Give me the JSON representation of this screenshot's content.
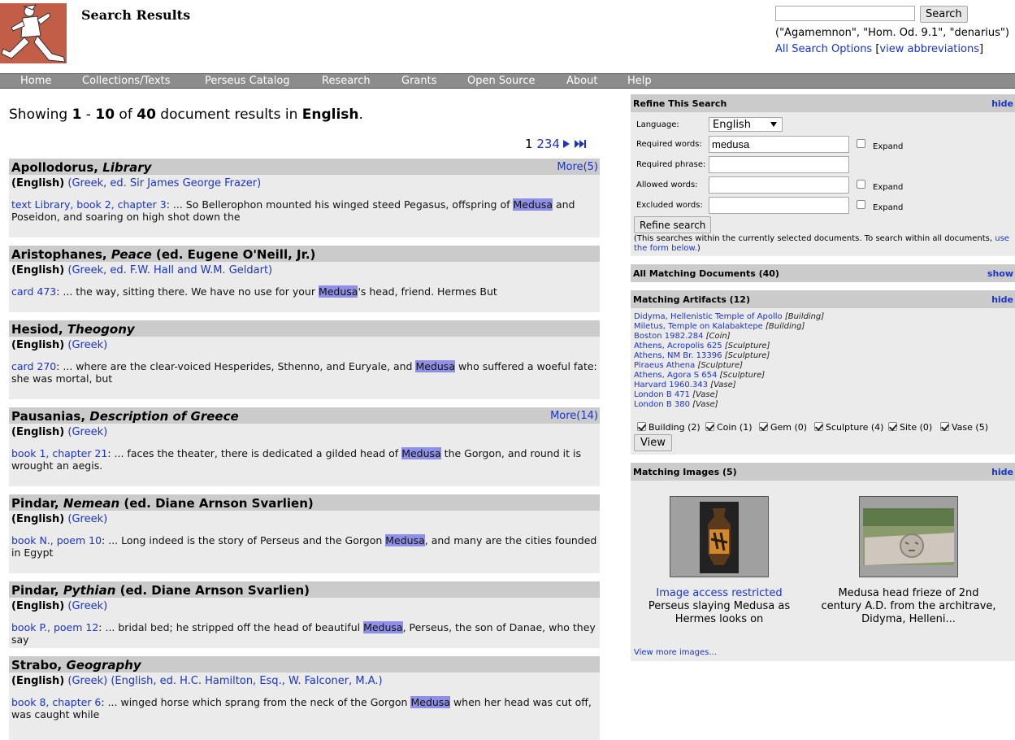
{
  "header": {
    "title": "Search Results",
    "search_value": "",
    "search_button": "Search",
    "search_hint": "(\"Agamemnon\", \"Hom. Od. 9.1\", \"denarius\")",
    "all_options": "All Search Options",
    "bracket_open": "[",
    "view_abbrev": "view abbreviations",
    "bracket_close": "]"
  },
  "nav": [
    "Home",
    "Collections/Texts",
    "Perseus Catalog",
    "Research",
    "Grants",
    "Open Source",
    "About",
    "Help"
  ],
  "summary": {
    "prefix": "Showing ",
    "from": "1",
    "dash": " - ",
    "to": "10",
    "of": " of ",
    "total": "40",
    "mid": " document results in ",
    "language": "English",
    "end": "."
  },
  "pager": {
    "current": "1",
    "pages": [
      "2",
      "3",
      "4"
    ]
  },
  "results": [
    {
      "author": "Apollodorus,",
      "work": "Library",
      "suffix": "",
      "more": "More(5)",
      "lang": "(English)",
      "sources": [
        {
          "label": "(Greek, ed. Sir James George Frazer)"
        }
      ],
      "ref": "text Library, book 2, chapter 3",
      "before": ": ... So Bellerophon mounted his winged steed Pegasus, offspring of ",
      "hit": "Medusa",
      "after": " and Poseidon, and soaring on high shot down the"
    },
    {
      "author": "Aristophanes,",
      "work": "Peace",
      "suffix": " (ed. Eugene O'Neill, Jr.)",
      "more": "",
      "lang": "(English)",
      "sources": [
        {
          "label": "(Greek, ed. F.W. Hall and W.M. Geldart)"
        }
      ],
      "ref": "card 473",
      "before": ": ... the way, sitting there. We have no use for your ",
      "hit": "Medusa",
      "after": "'s head, friend. Hermes But"
    },
    {
      "author": "Hesiod,",
      "work": "Theogony",
      "suffix": "",
      "more": "",
      "lang": "(English)",
      "sources": [
        {
          "label": "(Greek)"
        }
      ],
      "ref": "card 270",
      "before": ": ... where are the clear-voiced Hesperides, Sthenno, and Euryale, and ",
      "hit": "Medusa",
      "after": " who suffered a woeful fate: she was mortal, but"
    },
    {
      "author": "Pausanias,",
      "work": "Description of Greece",
      "suffix": "",
      "more": "More(14)",
      "lang": "(English)",
      "sources": [
        {
          "label": "(Greek)"
        }
      ],
      "ref": "book 1, chapter 21",
      "before": ": ... faces the theater, there is dedicated a gilded head of ",
      "hit": "Medusa",
      "after": " the Gorgon, and round it is wrought an aegis."
    },
    {
      "author": "Pindar,",
      "work": "Nemean",
      "suffix": " (ed. Diane Arnson Svarlien)",
      "more": "",
      "lang": "(English)",
      "sources": [
        {
          "label": "(Greek)"
        }
      ],
      "ref": "book N., poem 10",
      "before": ": ... Long indeed is the story of Perseus and the Gorgon ",
      "hit": "Medusa",
      "after": ", and many are the cities founded in Egypt"
    },
    {
      "author": "Pindar,",
      "work": "Pythian",
      "suffix": " (ed. Diane Arnson Svarlien)",
      "more": "",
      "lang": "(English)",
      "sources": [
        {
          "label": "(Greek)"
        }
      ],
      "ref": "book P., poem 12",
      "before": ": ... bridal bed; he stripped off the head of beautiful ",
      "hit": "Medusa",
      "after": ", Perseus, the son of Danae, who they say"
    },
    {
      "author": "Strabo,",
      "work": "Geography",
      "suffix": "",
      "more": "",
      "lang": "(English)",
      "sources": [
        {
          "label": "(Greek)"
        },
        {
          "label": "(English, ed. H.C. Hamilton, Esq., W. Falconer, M.A.)"
        }
      ],
      "ref": "book 8, chapter 6",
      "before": ": ... winged horse which sprang from the neck of the Gorgon ",
      "hit": "Medusa",
      "after": " when her head was cut off, was caught while"
    }
  ],
  "refine": {
    "title": "Refine This Search",
    "hide": "hide",
    "language_label": "Language:",
    "language_value": "English",
    "required_words_label": "Required words:",
    "required_words_value": "medusa",
    "required_phrase_label": "Required phrase:",
    "allowed_words_label": "Allowed words:",
    "excluded_words_label": "Excluded words:",
    "expand": "Expand",
    "button": "Refine search",
    "note_start": "(This searches within the currently selected documents. To search within all documents, ",
    "note_link": "use the form below.",
    "note_end": ")"
  },
  "all_docs": {
    "title": "All Matching Documents (40)",
    "show": "show"
  },
  "artifacts": {
    "title": "Matching Artifacts (12)",
    "hide": "hide",
    "items": [
      {
        "name": "Didyma, Hellenistic Temple of Apollo",
        "type": "[Building]"
      },
      {
        "name": "Miletus, Temple on Kalabaktepe",
        "type": "[Building]"
      },
      {
        "name": "Boston 1982.284",
        "type": "[Coin]"
      },
      {
        "name": "Athens, Acropolis 625",
        "type": "[Sculpture]"
      },
      {
        "name": "Athens, NM Br. 13396",
        "type": "[Sculpture]"
      },
      {
        "name": "Piraeus Athena",
        "type": "[Sculpture]"
      },
      {
        "name": "Athens, Agora S 654",
        "type": "[Sculpture]"
      },
      {
        "name": "Harvard 1960.343",
        "type": "[Vase]"
      },
      {
        "name": "London B 471",
        "type": "[Vase]"
      },
      {
        "name": "London B 380",
        "type": "[Vase]"
      }
    ],
    "types": [
      "Building (2)",
      "Coin (1)",
      "Gem (0)",
      "Sculpture (4)",
      "Site (0)",
      "Vase (5)"
    ],
    "view_button": "View"
  },
  "images": {
    "title": "Matching Images (5)",
    "hide": "hide",
    "img1_link": "Image access restricted",
    "img1_caption": "Perseus slaying Medusa as Hermes looks on",
    "img2_caption": "Medusa head frieze of 2nd century A.D. from the architrave, Didyma, Helleni...",
    "more": "View more images..."
  }
}
